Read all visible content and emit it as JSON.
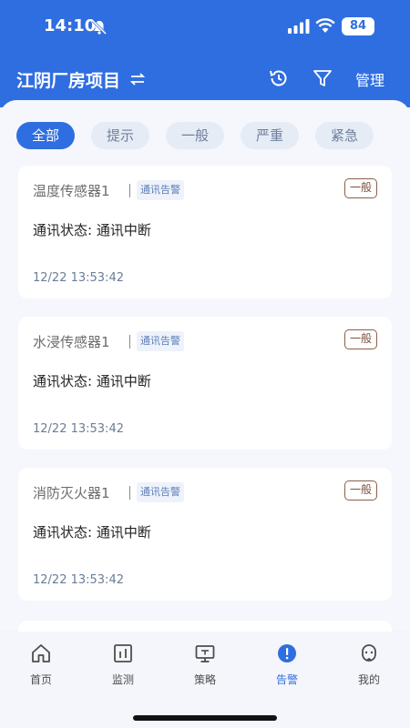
{
  "status_bar": {
    "time": "14:10",
    "battery": "84"
  },
  "header": {
    "project_title": "江阴厂房项目",
    "manage_label": "管理"
  },
  "tabs": [
    {
      "label": "全部",
      "active": true
    },
    {
      "label": "提示",
      "active": false
    },
    {
      "label": "一般",
      "active": false
    },
    {
      "label": "严重",
      "active": false
    },
    {
      "label": "紧急",
      "active": false
    }
  ],
  "alarms": [
    {
      "device": "温度传感器1",
      "tag": "通讯告警",
      "level": "一般",
      "status": "通讯状态: 通讯中断",
      "time": "12/22 13:53:42"
    },
    {
      "device": "水浸传感器1",
      "tag": "通讯告警",
      "level": "一般",
      "status": "通讯状态: 通讯中断",
      "time": "12/22 13:53:42"
    },
    {
      "device": "消防灭火器1",
      "tag": "通讯告警",
      "level": "一般",
      "status": "通讯状态: 通讯中断",
      "time": "12/22 13:53:42"
    }
  ],
  "nav": [
    {
      "label": "首页",
      "icon": "home-icon",
      "active": false
    },
    {
      "label": "监测",
      "icon": "monitor-icon",
      "active": false
    },
    {
      "label": "策略",
      "icon": "strategy-icon",
      "active": false
    },
    {
      "label": "告警",
      "icon": "alarm-icon",
      "active": true
    },
    {
      "label": "我的",
      "icon": "profile-icon",
      "active": false
    }
  ],
  "colors": {
    "primary": "#2f6ee0",
    "level_badge": "#8b5e4a"
  }
}
